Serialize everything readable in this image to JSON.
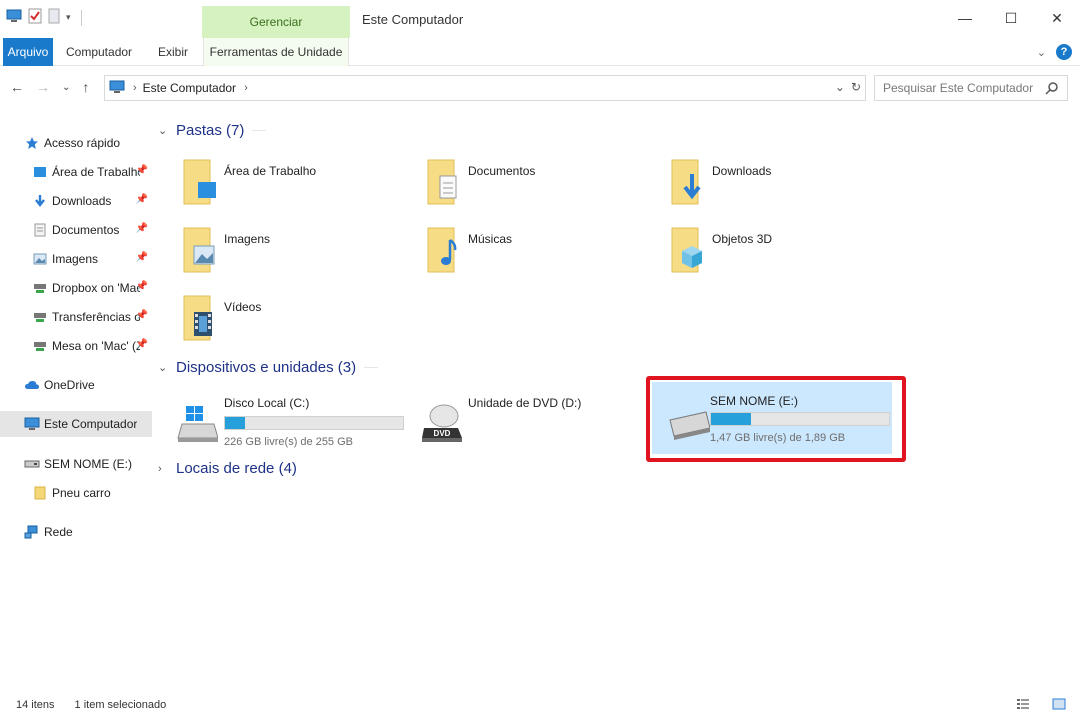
{
  "window": {
    "title": "Este Computador",
    "manage_tab": "Gerenciar",
    "minimize": "—",
    "maximize": "☐",
    "close": "✕"
  },
  "ribbon": {
    "tabs": [
      "Arquivo",
      "Computador",
      "Exibir",
      "Ferramentas de Unidade"
    ],
    "help": "?"
  },
  "navigation": {
    "back": "←",
    "forward": "→",
    "recent": "⌄",
    "up": "↑",
    "breadcrumb": "Este Computador",
    "search_placeholder": "Pesquisar Este Computador"
  },
  "sidebar": {
    "items": [
      {
        "label": "Acesso rápido",
        "icon": "star-icon",
        "pinned": false
      },
      {
        "label": "Área de Trabalho",
        "icon": "desktop-icon",
        "pinned": true
      },
      {
        "label": "Downloads",
        "icon": "download-icon",
        "pinned": true
      },
      {
        "label": "Documentos",
        "icon": "document-icon",
        "pinned": true
      },
      {
        "label": "Imagens",
        "icon": "image-icon",
        "pinned": true
      },
      {
        "label": "Dropbox on 'Mac'",
        "icon": "network-drive-icon",
        "pinned": true
      },
      {
        "label": "Transferências on 'Mac'",
        "icon": "network-drive-icon",
        "pinned": true
      },
      {
        "label": "Mesa on 'Mac' (Z:)",
        "icon": "network-drive-icon",
        "pinned": true
      },
      {
        "label": "OneDrive",
        "icon": "cloud-icon",
        "pinned": false
      },
      {
        "label": "Este Computador",
        "icon": "computer-icon",
        "pinned": false,
        "selected": true
      },
      {
        "label": "SEM NOME (E:)",
        "icon": "usb-drive-icon",
        "pinned": false
      },
      {
        "label": "Pneu carro",
        "icon": "folder-icon",
        "pinned": false
      },
      {
        "label": "Rede",
        "icon": "network-icon",
        "pinned": false
      }
    ]
  },
  "groups": {
    "folders": "Pastas (7)",
    "devices": "Dispositivos e unidades (3)",
    "network": "Locais de rede (4)"
  },
  "folders": [
    {
      "name": "Área de Trabalho",
      "icon": "desktop-folder-icon"
    },
    {
      "name": "Documentos",
      "icon": "documents-folder-icon"
    },
    {
      "name": "Downloads",
      "icon": "downloads-folder-icon"
    },
    {
      "name": "Imagens",
      "icon": "pictures-folder-icon"
    },
    {
      "name": "Músicas",
      "icon": "music-folder-icon"
    },
    {
      "name": "Objetos 3D",
      "icon": "objects3d-folder-icon"
    },
    {
      "name": "Vídeos",
      "icon": "videos-folder-icon"
    }
  ],
  "drives": [
    {
      "name": "Disco Local (C:)",
      "free": "226 GB livre(s) de 255 GB",
      "used_fraction": 0.114,
      "icon": "windows-drive-icon"
    },
    {
      "name": "Unidade de DVD (D:)",
      "icon": "dvd-drive-icon",
      "dvd_label": "DVD"
    },
    {
      "name": "SEM NOME (E:)",
      "free": "1,47 GB livre(s) de 1,89 GB",
      "used_fraction": 0.222,
      "icon": "usb-drive-icon",
      "selected": true
    }
  ],
  "status": {
    "count": "14 itens",
    "selection": "1 item selecionado"
  },
  "colors": {
    "accent": "#1979ca",
    "selection": "#cce8ff",
    "highlight_border": "#e0141e",
    "bar_fill": "#26a0da",
    "manage_tab": "#d6f2c0"
  }
}
